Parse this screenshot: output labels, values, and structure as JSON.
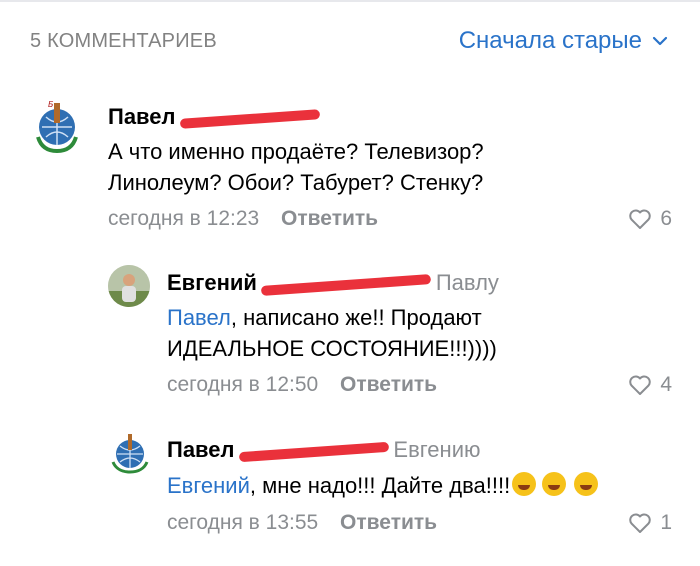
{
  "header": {
    "count_label": "5 КОММЕНТАРИЕВ",
    "sort_label": "Сначала старые"
  },
  "comments": [
    {
      "author": "Павел",
      "reply_to": "",
      "mention": "",
      "text_lines": [
        "А что именно продаёте? Телевизор?",
        "Линолеум? Обои? Табурет? Стенку?"
      ],
      "time": "сегодня в 12:23",
      "reply_label": "Ответить",
      "likes": "6"
    },
    {
      "author": "Евгений",
      "reply_to": "Павлу",
      "mention": "Павел",
      "text_lines": [
        ", написано же!! Продают",
        "ИДЕАЛЬНОЕ СОСТОЯНИЕ!!!))))"
      ],
      "time": "сегодня в 12:50",
      "reply_label": "Ответить",
      "likes": "4"
    },
    {
      "author": "Павел",
      "reply_to": "Евгению",
      "mention": "Евгений",
      "text_lines": [
        ", мне надо!!! Дайте два!!!!"
      ],
      "time": "сегодня в 13:55",
      "reply_label": "Ответить",
      "likes": "1"
    }
  ],
  "icons": {
    "sort": "chevron-down-icon",
    "like": "heart-icon",
    "emoji": "rofl-emoji-icon"
  },
  "colors": {
    "accent": "#2a73c9",
    "muted": "#8a8d91",
    "redaction": "#e8202a"
  }
}
